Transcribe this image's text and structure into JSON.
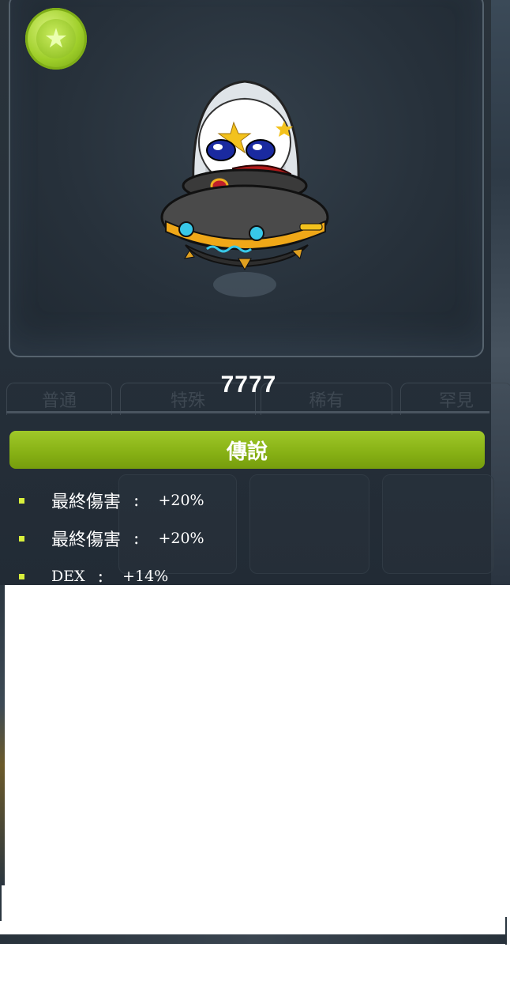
{
  "pet": {
    "name": "7777"
  },
  "background_tabs": [
    "普通",
    "特殊",
    "稀有",
    "罕見"
  ],
  "rarity": {
    "label": "傳說",
    "color": "#8ab516"
  },
  "stats": [
    {
      "name": "最終傷害",
      "sep": ":",
      "value": "+20%"
    },
    {
      "name": "最終傷害",
      "sep": ":",
      "value": "+20%"
    },
    {
      "name": "DEX",
      "sep": ":",
      "value": "+14%"
    }
  ],
  "icons": {
    "badge": "star-badge-icon",
    "bullet": "square-bullet-icon"
  }
}
